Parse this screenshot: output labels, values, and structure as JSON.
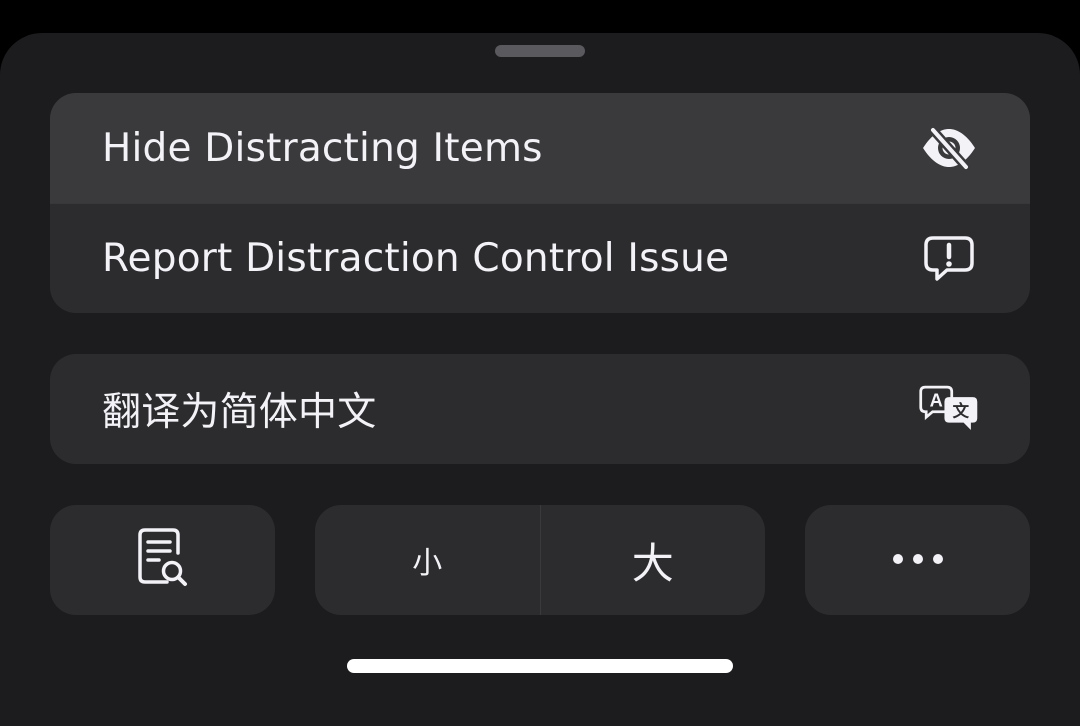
{
  "menu": {
    "items": [
      {
        "label": "Hide Distracting Items",
        "icon": "eye-slash-icon"
      },
      {
        "label": "Report Distraction Control Issue",
        "icon": "exclamation-bubble-icon"
      }
    ],
    "translate": {
      "label": "翻译为简体中文",
      "icon": "translate-icon"
    }
  },
  "toolbar": {
    "reader_icon": "document-magnifier-icon",
    "font_small_label": "小",
    "font_large_label": "大",
    "more_icon": "ellipsis-icon"
  },
  "colors": {
    "sheet_bg": "#1c1c1e",
    "group_bg": "#2c2c2e",
    "highlight_bg": "#3a3a3c",
    "text": "#f2f2f7"
  }
}
